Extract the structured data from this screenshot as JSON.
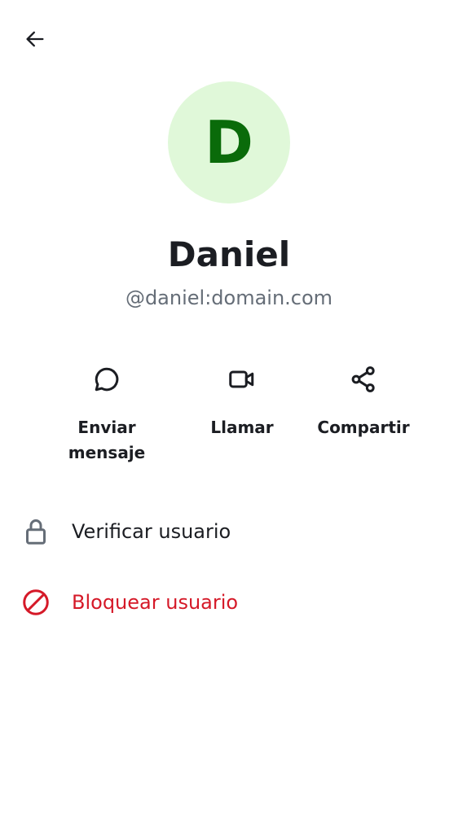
{
  "header": {
    "back_icon": "arrow-left-icon"
  },
  "profile": {
    "avatar_initial": "D",
    "display_name": "Daniel",
    "user_id": "@daniel:domain.com",
    "avatar_bg": "#e0f8d9",
    "avatar_fg": "#0a6b0a"
  },
  "actions": [
    {
      "icon": "chat-bubble-icon",
      "label": "Enviar mensaje"
    },
    {
      "icon": "video-camera-icon",
      "label": "Llamar"
    },
    {
      "icon": "share-icon",
      "label": "Compartir"
    }
  ],
  "menu": {
    "verify": {
      "icon": "lock-icon",
      "label": "Verificar usuario"
    },
    "block": {
      "icon": "block-icon",
      "label": "Bloquear usuario",
      "color": "#d51928"
    }
  }
}
